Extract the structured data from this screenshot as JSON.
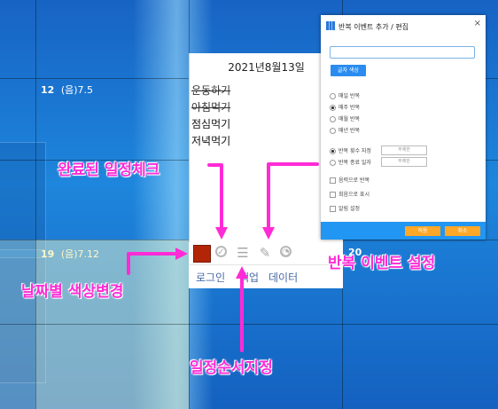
{
  "calendar": {
    "day1": {
      "date": "12",
      "lunar": "(음)7.5"
    },
    "day2": {
      "date": "19",
      "lunar": "(음)7.12"
    },
    "day3": {
      "date": "20"
    }
  },
  "memo": {
    "date_header": "2021년8월13일",
    "todos": [
      {
        "text": "운동하기",
        "done": true
      },
      {
        "text": "아침먹기",
        "done": true
      },
      {
        "text": "점심먹기",
        "done": false
      },
      {
        "text": "저녁먹기",
        "done": false
      }
    ],
    "selected_color": "#b22507",
    "bottom_menu": [
      "로그인",
      "백업",
      "데이터"
    ]
  },
  "dialog": {
    "title": "반복 이벤트 추가 / 편집",
    "close": "×",
    "text_color_button": "글자 색상",
    "repeat_options": [
      {
        "label": "매일 반복",
        "selected": false
      },
      {
        "label": "매주 반복",
        "selected": true
      },
      {
        "label": "매월 반복",
        "selected": false
      },
      {
        "label": "매년 반복",
        "selected": false
      }
    ],
    "limit_options": [
      {
        "label": "반복 횟수 지정",
        "selected": true,
        "value": "무제한"
      },
      {
        "label": "반복 종료 일자",
        "selected": false,
        "value": "무제한"
      }
    ],
    "checkboxes": [
      "음력으로 반복",
      "회음으로 표시",
      "알림 설정"
    ],
    "ok_button": "적용",
    "cancel_button": "취소"
  },
  "annotations": {
    "complete_check": "완료된 일정체크",
    "repeat_event": "반복 이벤트 설정",
    "date_color": "날짜별 색상변경",
    "order": "일정순서지정"
  },
  "colors": {
    "annotation": "#ff2bd6",
    "dialog_footer": "#2196f3",
    "dialog_buttons": "#ffa726"
  }
}
